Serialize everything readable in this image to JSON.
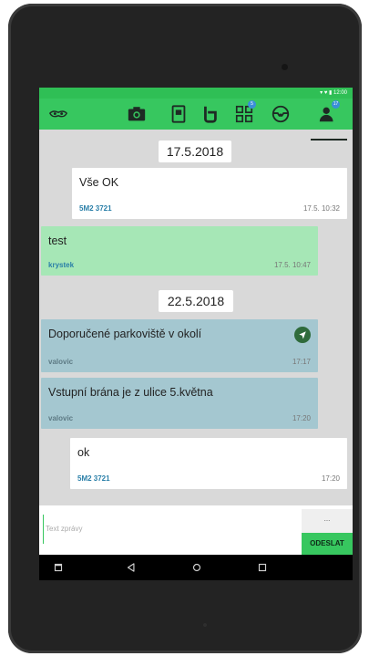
{
  "status": {
    "time": "12:00"
  },
  "toolbar": {
    "badges": {
      "grid": "5",
      "person": "17"
    }
  },
  "dates": [
    "17.5.2018",
    "22.5.2018"
  ],
  "messages": [
    {
      "text": "Vše OK",
      "sender": "5M2 3721",
      "time": "17.5. 10:32"
    },
    {
      "text": "test",
      "sender": "krystek",
      "time": "17.5. 10:47"
    },
    {
      "text": "Doporučené parkoviště v okolí",
      "sender": "valovic",
      "time": "17:17"
    },
    {
      "text": "Vstupní brána je z ulice 5.května",
      "sender": "valovic",
      "time": "17:20"
    },
    {
      "text": "ok",
      "sender": "5M2 3721",
      "time": "17:20"
    }
  ],
  "composer": {
    "placeholder": "Text zprávy",
    "counter": "...",
    "send_label": "ODESLAT"
  },
  "colors": {
    "accent": "#37c75f",
    "incoming": "#a6e7b6",
    "info": "#a4c7d0"
  }
}
